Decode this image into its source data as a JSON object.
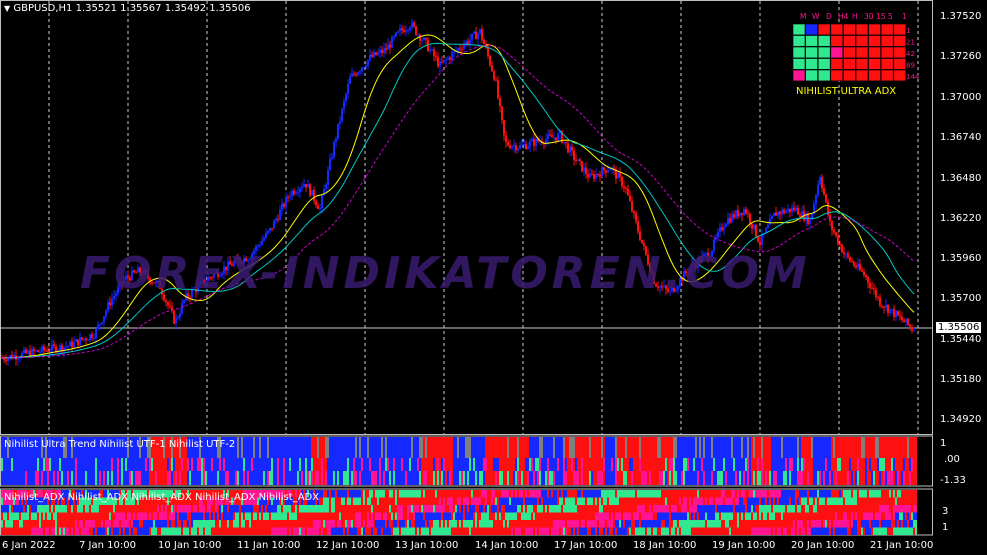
{
  "header": {
    "menu_icon": "triangle-down-icon",
    "symbol": "GBPUSD,H1",
    "open": "1.35521",
    "high": "1.35567",
    "low": "1.35492",
    "close": "1.35506"
  },
  "price_axis": {
    "labels": [
      "1.37520",
      "1.37260",
      "1.37000",
      "1.36740",
      "1.36480",
      "1.36220",
      "1.35960",
      "1.35700",
      "1.35440",
      "1.35180",
      "1.34920"
    ],
    "current_price": "1.35506"
  },
  "time_axis": {
    "labels": [
      "6 Jan 2022",
      "7 Jan 10:00",
      "10 Jan 10:00",
      "11 Jan 10:00",
      "12 Jan 10:00",
      "13 Jan 10:00",
      "14 Jan 10:00",
      "17 Jan 10:00",
      "18 Jan 10:00",
      "19 Jan 10:00",
      "20 Jan 10:00",
      "21 Jan 10:00"
    ]
  },
  "watermark": "FOREX-INDIKATOREN.COM",
  "dashboard": {
    "title": "NIHILIST-ULTRA ADX",
    "timeframes": [
      "M",
      "W",
      "D",
      "H4",
      "H",
      "30",
      "15",
      "5",
      "1"
    ],
    "row_values": [
      "1",
      "21",
      "42",
      "89",
      "144"
    ]
  },
  "subwindow1": {
    "labels": [
      "Nihilist Ultra Trend",
      "Nihilist UTF-1",
      "Nihilist UTF-2"
    ],
    "axis": [
      "1",
      ".00",
      "-1.33"
    ]
  },
  "subwindow2": {
    "labels": [
      "Nihilist_ADX",
      "Nihilist_ADX",
      "Nihilist_ADX",
      "Nihilist_ADX",
      "Nihilist_ADX"
    ],
    "axis": [
      "3",
      "1"
    ]
  },
  "colors": {
    "bull": "#1428ff",
    "bear": "#ff1010",
    "grey": "#808080",
    "pink": "#ff1493",
    "mint": "#30e890",
    "ma_fast": "#ffff00",
    "ma_mid": "#00c8c8",
    "ma_slow": "#cc00cc"
  }
}
